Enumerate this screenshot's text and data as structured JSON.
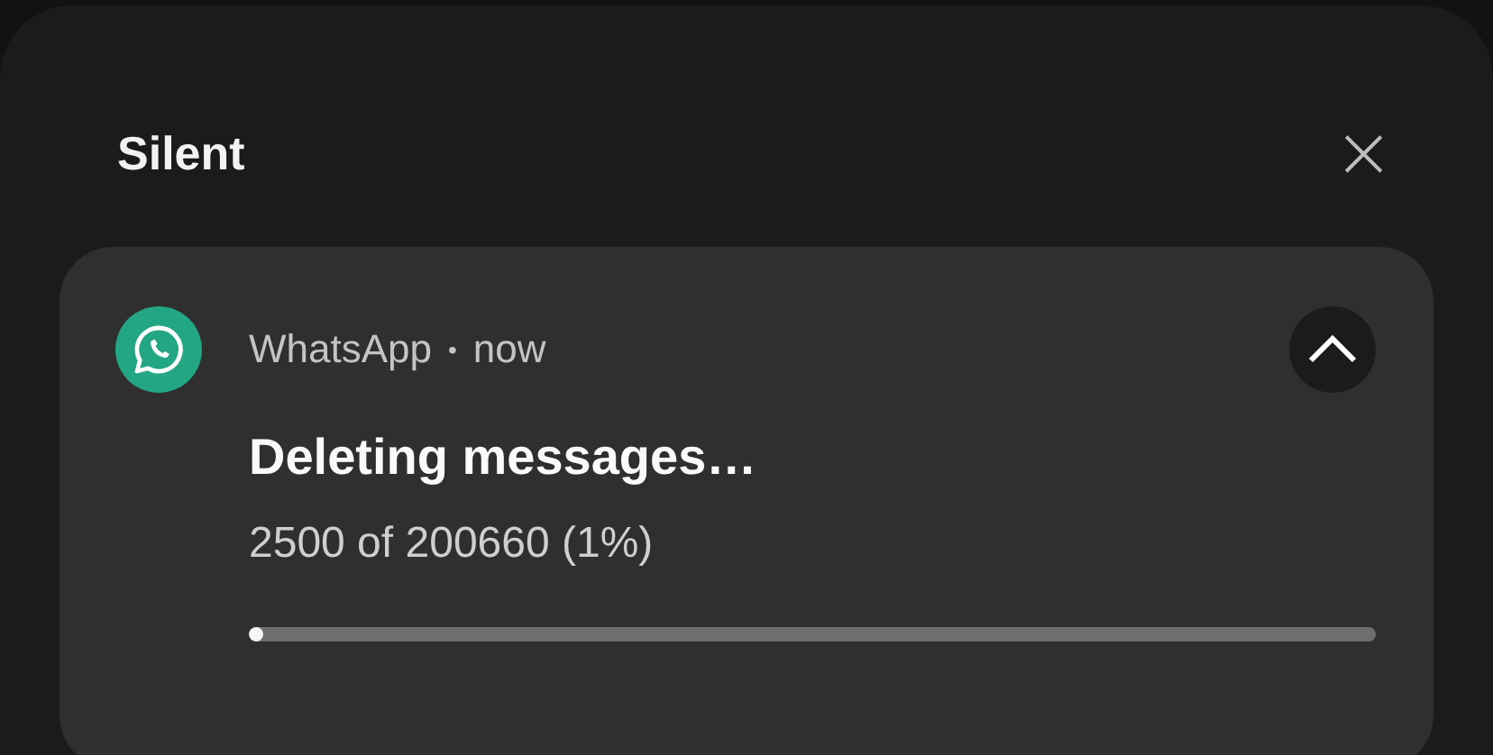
{
  "section": {
    "title": "Silent",
    "close": "×"
  },
  "notification": {
    "app": "WhatsApp",
    "separator": "•",
    "time": "now",
    "expanded": true,
    "title": "Deleting messages…",
    "text": "2500 of 200660 (1%)",
    "progress": {
      "level": 0.01
    }
  }
}
